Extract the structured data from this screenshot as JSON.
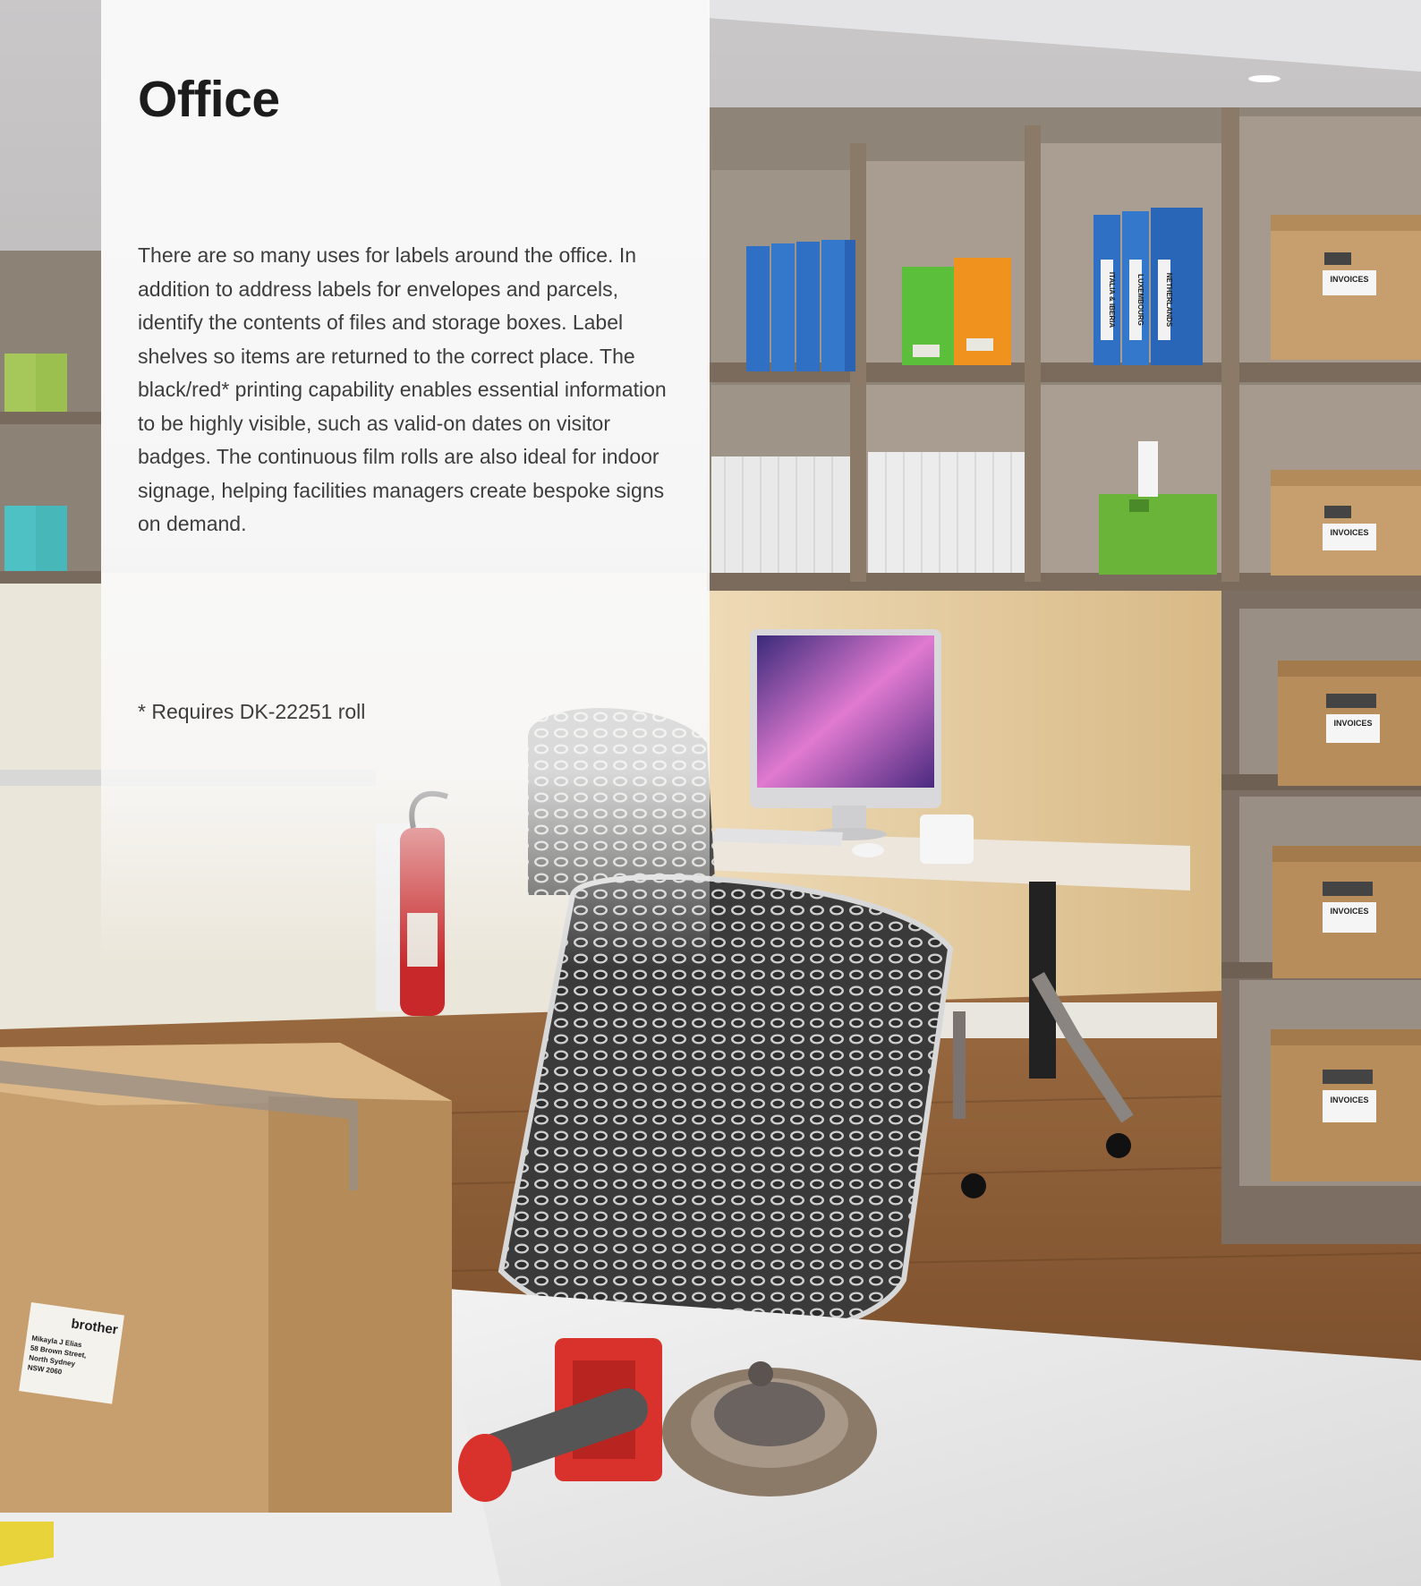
{
  "page": {
    "title": "Office",
    "body": "There are so many uses for labels around the office. In addition to address labels for envelopes and parcels, identify the contents of files and storage boxes. Label shelves so items are returned to the correct place. The black/red* printing capability enables essential information to be highly visible, such as valid-on dates on visitor badges. The continuous film rolls are also ideal for indoor signage, helping facilities managers create bespoke signs on demand.",
    "footnote": "* Requires DK-22251 roll"
  },
  "photo": {
    "box_labels": [
      "INVOICES",
      "INVOICES",
      "INVOICES",
      "INVOICES",
      "INVOICES"
    ],
    "binder_labels": [
      "ITALIA & IBERIA",
      "LUXEMBOURG",
      "NETHERLANDS"
    ],
    "parcel_label": {
      "brand": "brother",
      "lines": [
        "Mikayla J Elias",
        "58 Brown Street,",
        "North Sydney",
        "NSW 2060"
      ]
    }
  },
  "colors": {
    "title": "#1c1c1c",
    "text": "#3d3d3d",
    "panel": "#fafafa",
    "wall": "#e8cfa0",
    "floor": "#8a5a34",
    "shelf": "#7a6a5a",
    "cardboard": "#c79f6e",
    "binder_blue": "#2f6fc4",
    "tape_red": "#d9312b"
  }
}
